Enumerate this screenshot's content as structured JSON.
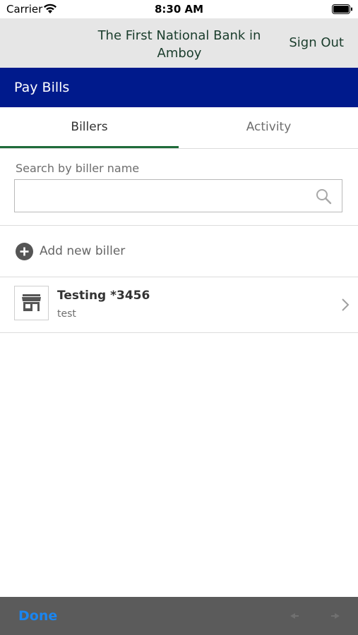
{
  "status_bar": {
    "carrier": "Carrier",
    "time": "8:30 AM",
    "icons": [
      "wifi-icon",
      "battery-icon"
    ]
  },
  "header": {
    "bank_name": "The First National Bank in Amboy",
    "sign_out_label": "Sign Out"
  },
  "banner": {
    "title": "Pay Bills"
  },
  "tabs": [
    {
      "label": "Billers",
      "selected": true
    },
    {
      "label": "Activity",
      "selected": false
    }
  ],
  "search": {
    "label": "Search by biller name",
    "value": "",
    "placeholder": "",
    "icon": "search-icon"
  },
  "add_biller": {
    "label": "Add new biller",
    "icon": "add-circle-icon"
  },
  "billers": [
    {
      "name": "Testing *3456",
      "nickname": "test",
      "icon": "store-icon"
    }
  ],
  "keyboard_toolbar": {
    "done_label": "Done",
    "icons": [
      "prev-arrow-icon",
      "next-arrow-icon"
    ]
  },
  "colors": {
    "banner": "#001a8c",
    "header_bg": "#e6e6e6",
    "header_text": "#1a3d2c",
    "tab_indicator": "#1f6b3a",
    "done": "#1b86f0",
    "toolbar_bg": "#5b5b5b"
  }
}
